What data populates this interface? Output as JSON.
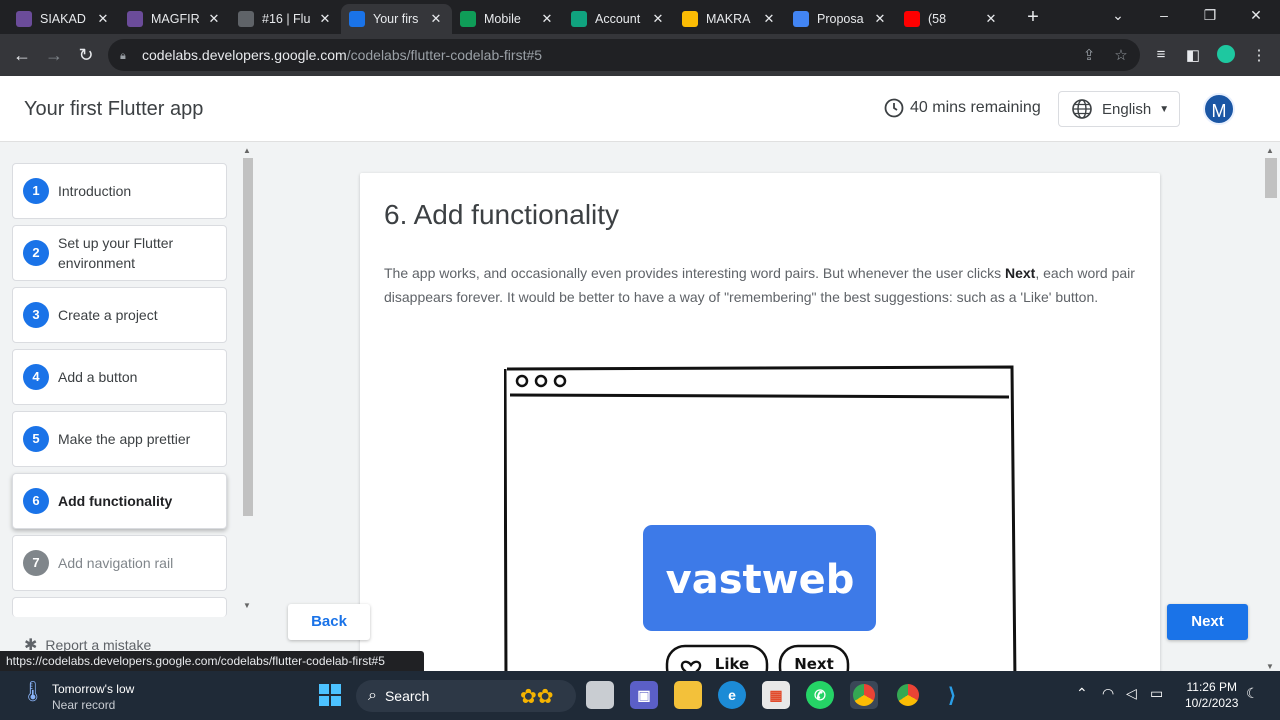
{
  "browser": {
    "tabs": [
      {
        "title": "SIAKAD",
        "icon": "university-seal-icon",
        "color": "#6b4c9a"
      },
      {
        "title": "MAGFIR",
        "icon": "university-seal-icon",
        "color": "#6b4c9a"
      },
      {
        "title": "#16 | Flu",
        "icon": "globe-icon",
        "color": "#5f6368"
      },
      {
        "title": "Your firs",
        "icon": "codelabs-icon",
        "color": "#1a73e8"
      },
      {
        "title": "Mobile",
        "icon": "sheets-icon",
        "color": "#0f9d58"
      },
      {
        "title": "Account",
        "icon": "openai-icon",
        "color": "#10a37f"
      },
      {
        "title": "MAKRA",
        "icon": "drive-icon",
        "color": "#fbbc04"
      },
      {
        "title": "Proposa",
        "icon": "docs-icon",
        "color": "#4285f4"
      },
      {
        "title": "(58",
        "icon": "youtube-icon",
        "color": "#ff0000"
      }
    ],
    "active_tab": 3,
    "url_host": "codelabs.developers.google.com",
    "url_path": "/codelabs/flutter-codelab-first#5"
  },
  "header": {
    "title": "Your first Flutter app",
    "time_remaining": "40 mins remaining",
    "language": "English",
    "avatar_initial": "M"
  },
  "sidebar": {
    "steps": [
      {
        "num": "1",
        "label": "Introduction",
        "state": "done"
      },
      {
        "num": "2",
        "label": "Set up your Flutter environment",
        "state": "done"
      },
      {
        "num": "3",
        "label": "Create a project",
        "state": "done"
      },
      {
        "num": "4",
        "label": "Add a button",
        "state": "done"
      },
      {
        "num": "5",
        "label": "Make the app prettier",
        "state": "done"
      },
      {
        "num": "6",
        "label": "Add functionality",
        "state": "current"
      },
      {
        "num": "7",
        "label": "Add navigation rail",
        "state": "future"
      }
    ],
    "report_label": "Report a mistake"
  },
  "content": {
    "title": "6. Add functionality",
    "paragraph_before": "The app works, and occasionally even provides interesting word pairs. But whenever the user clicks ",
    "paragraph_bold": "Next",
    "paragraph_after": ", each word pair disappears forever. It would be better to have a way of \"remembering\" the best suggestions: such as a 'Like' button.",
    "sketch_word": "vastweb",
    "sketch_like": "Like",
    "sketch_next": "Next"
  },
  "nav": {
    "back_label": "Back",
    "next_label": "Next"
  },
  "status_url": "https://codelabs.developers.google.com/codelabs/flutter-codelab-first#5",
  "taskbar": {
    "weather_line1": "Tomorrow's low",
    "weather_line2": "Near record",
    "search_label": "Search",
    "time": "11:26 PM",
    "date": "10/2/2023"
  },
  "colors": {
    "accent": "#1a73e8",
    "chip_blue": "#3d7ae8",
    "taskbar": "#1f2a37"
  }
}
